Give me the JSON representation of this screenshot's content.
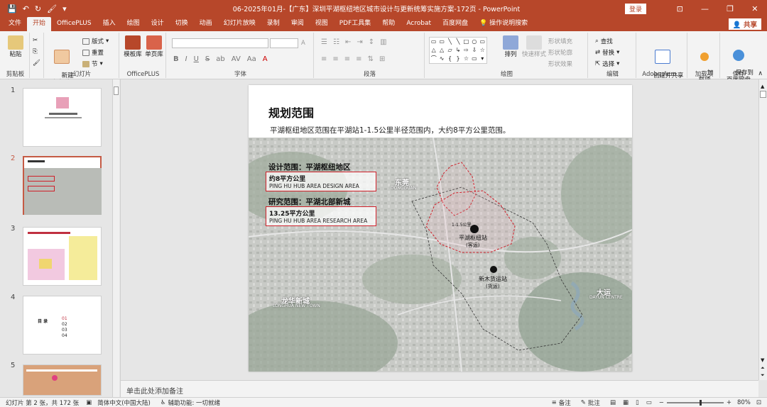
{
  "window": {
    "title": "06-2025年01月-【广东】深圳平湖枢纽地区城市设计与更新统筹实施方案-172页  -  PowerPoint",
    "login_label": "登录",
    "share_label": "共享"
  },
  "tabs": [
    "文件",
    "开始",
    "OfficePLUS",
    "插入",
    "绘图",
    "设计",
    "切换",
    "动画",
    "幻灯片放映",
    "录制",
    "审阅",
    "视图",
    "PDF工具集",
    "帮助",
    "Acrobat",
    "百度网盘"
  ],
  "active_tab": "开始",
  "tell_me": "操作说明搜索",
  "ribbon": {
    "clipboard": {
      "paste": "粘贴",
      "group": "剪贴板"
    },
    "slides": {
      "new_slide": "新建\n幻灯片",
      "layout": "版式",
      "reset": "重置",
      "section": "节",
      "group": "幻灯片"
    },
    "officeplus": {
      "template": "模板库",
      "single": "单页库",
      "group": "OfficePLUS"
    },
    "font": {
      "group": "字体",
      "bold": "B",
      "italic": "I",
      "underline": "U",
      "strike": "S",
      "shadow": "ab",
      "spacing": "AV",
      "case": "Aa",
      "color": "A"
    },
    "paragraph": {
      "group": "段落"
    },
    "drawing": {
      "arrange": "排列",
      "quick_styles": "快速样式",
      "fill": "形状填充",
      "outline": "形状轮廓",
      "effects": "形状效果",
      "group": "绘图"
    },
    "editing": {
      "find": "查找",
      "replace": "替换",
      "select": "选择",
      "group": "编辑"
    },
    "adobe": {
      "create": "创建并共享\nAdobe PDF",
      "group": "Adobe Acro..."
    },
    "addins": {
      "add": "加\n载项",
      "group": "加载项"
    },
    "save": {
      "save_baidu": "保存到\n百度网盘",
      "group": "保存"
    }
  },
  "thumbnails": [
    {
      "num": "1"
    },
    {
      "num": "2"
    },
    {
      "num": "3"
    },
    {
      "num": "4"
    },
    {
      "num": "5"
    }
  ],
  "thumb4": {
    "title": "目 录",
    "items": [
      "01",
      "02",
      "03",
      "04"
    ]
  },
  "slide": {
    "title": "规划范围",
    "subtitle": "平湖枢纽地区范围在平湖站1-1.5公里半径范围内，大约8平方公里范围。",
    "design_box": {
      "heading": "设计范围：平湖枢纽地区",
      "area": "约8平方公里",
      "english": "PING HU HUB AREA DESIGN AREA"
    },
    "research_box": {
      "heading": "研究范围：平湖北部新城",
      "area": "13.25平方公里",
      "english": "PING HU HUB AREA RESEARCH AREA"
    },
    "map_labels": {
      "east": "东莞",
      "east_en": "DONGGUAN",
      "station": "平湖枢纽站",
      "station_sub": "(客运)",
      "freight": "新木货运站",
      "freight_sub": "(货运)",
      "dayun": "大运",
      "dayun_en": "DAYUN CENTRE",
      "longhua": "龙华新城",
      "longhua_en": "LONGHUA NEW TOWN",
      "radius": "1-1.5公里"
    }
  },
  "notes_placeholder": "单击此处添加备注",
  "status": {
    "slide_count": "幻灯片 第 2 张，共 172 张",
    "language": "简体中文(中国大陆)",
    "accessibility": "辅助功能: 一切就绪",
    "notes": "备注",
    "comments": "批注",
    "zoom": "80%"
  }
}
